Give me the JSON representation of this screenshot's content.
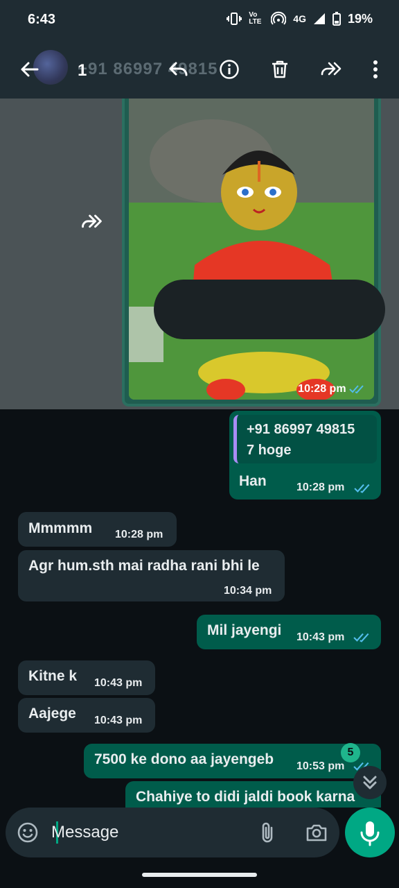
{
  "status_bar": {
    "time": "6:43",
    "battery": "19%",
    "network": "4G",
    "volte": "Vo LTE"
  },
  "header": {
    "selected_count": "1",
    "ghost_title": "+91 86997 49815"
  },
  "media_message": {
    "time": "10:28 pm",
    "status": "read"
  },
  "messages": [
    {
      "direction": "out",
      "quote_sender": "+91 86997 49815",
      "quote_text": "7 hoge",
      "text": "Han",
      "time": "10:28 pm",
      "status": "read"
    },
    {
      "direction": "in",
      "text": "Mmmmm",
      "time": "10:28 pm"
    },
    {
      "direction": "in",
      "text": "Agr hum.sth mai radha rani bhi le",
      "time": "10:34 pm"
    },
    {
      "direction": "out",
      "text": "Mil jayengi",
      "time": "10:43 pm",
      "status": "read"
    },
    {
      "direction": "in",
      "text": "Kitne k",
      "time": "10:43 pm"
    },
    {
      "direction": "in",
      "text": "Aajege",
      "time": "10:43 pm"
    },
    {
      "direction": "out",
      "text": "7500 ke dono aa jayengeb",
      "time": "10:53 pm",
      "status": "read"
    },
    {
      "direction": "out",
      "text": "Chahiye to didi jaldi book karna",
      "time": ""
    }
  ],
  "unread_badge": "5",
  "composer": {
    "placeholder": "Message"
  },
  "colors": {
    "accent": "#00a884",
    "outgoing": "#005c4b",
    "incoming": "#1f2c33",
    "read_tick": "#53bdeb"
  }
}
